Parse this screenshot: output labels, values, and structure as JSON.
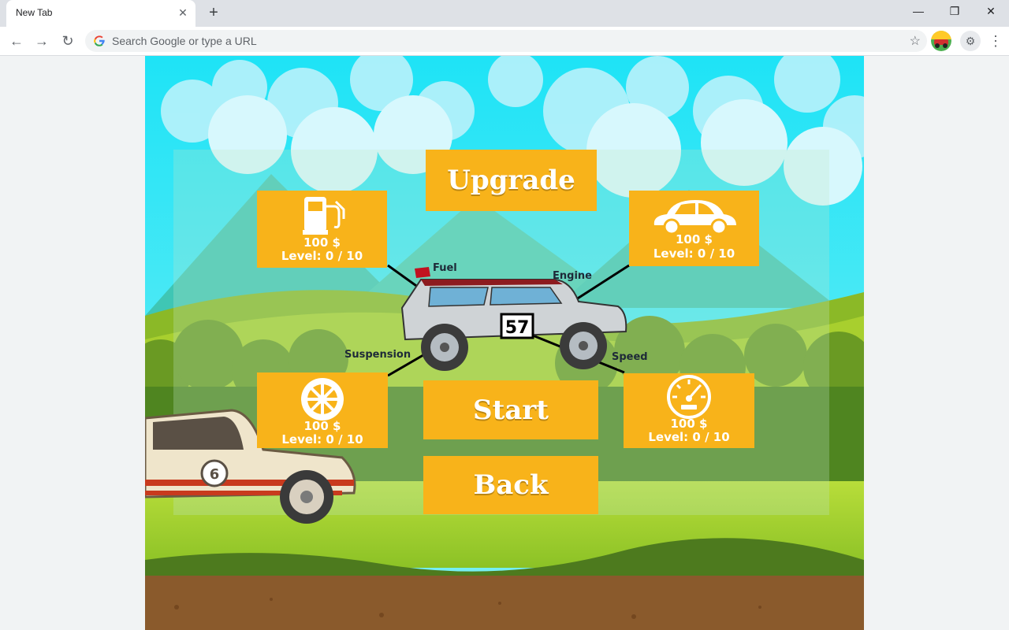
{
  "browser": {
    "tab_title": "New Tab",
    "tab_close": "✕",
    "new_tab": "+",
    "omnibox_placeholder": "Search Google or type a URL",
    "icons": [
      "back-arrow-icon",
      "forward-arrow-icon",
      "reload-icon",
      "google-icon",
      "star-icon",
      "extension-avatar-icon",
      "puzzle-icon",
      "menu-icon"
    ]
  },
  "game": {
    "title_button": "Upgrade",
    "start_button": "Start",
    "back_button": "Back",
    "car_number": "57",
    "side_car_number": "6",
    "upgrades": [
      {
        "id": "fuel",
        "part_label": "Fuel",
        "icon": "fuel-pump-icon",
        "price": "100 $",
        "level": "Level: 0 / 10"
      },
      {
        "id": "engine",
        "part_label": "Engine",
        "icon": "car-icon",
        "price": "100 $",
        "level": "Level: 0 / 10"
      },
      {
        "id": "suspension",
        "part_label": "Suspension",
        "icon": "wheel-icon",
        "price": "100 $",
        "level": "Level: 0 / 10"
      },
      {
        "id": "speed",
        "part_label": "Speed",
        "icon": "speedometer-icon",
        "price": "100 $",
        "level": "Level: 0 / 10"
      }
    ],
    "colors": {
      "button": "#f8b31a",
      "sky": "#2de6f5",
      "grass": "#a6d12c",
      "dirt": "#8a5a2c"
    }
  }
}
